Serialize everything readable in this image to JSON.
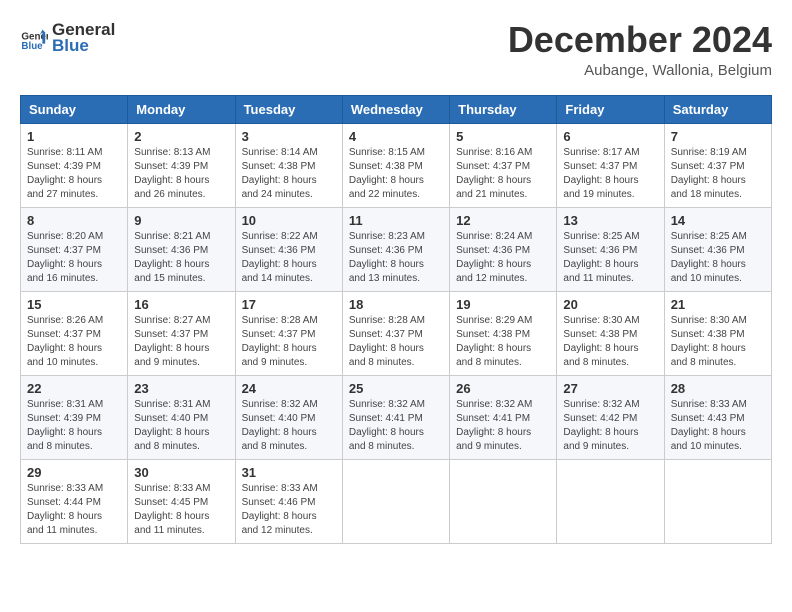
{
  "header": {
    "logo_general": "General",
    "logo_blue": "Blue",
    "month_title": "December 2024",
    "subtitle": "Aubange, Wallonia, Belgium"
  },
  "days_of_week": [
    "Sunday",
    "Monday",
    "Tuesday",
    "Wednesday",
    "Thursday",
    "Friday",
    "Saturday"
  ],
  "weeks": [
    [
      {
        "day": "1",
        "sunrise": "8:11 AM",
        "sunset": "4:39 PM",
        "daylight": "8 hours and 27 minutes."
      },
      {
        "day": "2",
        "sunrise": "8:13 AM",
        "sunset": "4:39 PM",
        "daylight": "8 hours and 26 minutes."
      },
      {
        "day": "3",
        "sunrise": "8:14 AM",
        "sunset": "4:38 PM",
        "daylight": "8 hours and 24 minutes."
      },
      {
        "day": "4",
        "sunrise": "8:15 AM",
        "sunset": "4:38 PM",
        "daylight": "8 hours and 22 minutes."
      },
      {
        "day": "5",
        "sunrise": "8:16 AM",
        "sunset": "4:37 PM",
        "daylight": "8 hours and 21 minutes."
      },
      {
        "day": "6",
        "sunrise": "8:17 AM",
        "sunset": "4:37 PM",
        "daylight": "8 hours and 19 minutes."
      },
      {
        "day": "7",
        "sunrise": "8:19 AM",
        "sunset": "4:37 PM",
        "daylight": "8 hours and 18 minutes."
      }
    ],
    [
      {
        "day": "8",
        "sunrise": "8:20 AM",
        "sunset": "4:37 PM",
        "daylight": "8 hours and 16 minutes."
      },
      {
        "day": "9",
        "sunrise": "8:21 AM",
        "sunset": "4:36 PM",
        "daylight": "8 hours and 15 minutes."
      },
      {
        "day": "10",
        "sunrise": "8:22 AM",
        "sunset": "4:36 PM",
        "daylight": "8 hours and 14 minutes."
      },
      {
        "day": "11",
        "sunrise": "8:23 AM",
        "sunset": "4:36 PM",
        "daylight": "8 hours and 13 minutes."
      },
      {
        "day": "12",
        "sunrise": "8:24 AM",
        "sunset": "4:36 PM",
        "daylight": "8 hours and 12 minutes."
      },
      {
        "day": "13",
        "sunrise": "8:25 AM",
        "sunset": "4:36 PM",
        "daylight": "8 hours and 11 minutes."
      },
      {
        "day": "14",
        "sunrise": "8:25 AM",
        "sunset": "4:36 PM",
        "daylight": "8 hours and 10 minutes."
      }
    ],
    [
      {
        "day": "15",
        "sunrise": "8:26 AM",
        "sunset": "4:37 PM",
        "daylight": "8 hours and 10 minutes."
      },
      {
        "day": "16",
        "sunrise": "8:27 AM",
        "sunset": "4:37 PM",
        "daylight": "8 hours and 9 minutes."
      },
      {
        "day": "17",
        "sunrise": "8:28 AM",
        "sunset": "4:37 PM",
        "daylight": "8 hours and 9 minutes."
      },
      {
        "day": "18",
        "sunrise": "8:28 AM",
        "sunset": "4:37 PM",
        "daylight": "8 hours and 8 minutes."
      },
      {
        "day": "19",
        "sunrise": "8:29 AM",
        "sunset": "4:38 PM",
        "daylight": "8 hours and 8 minutes."
      },
      {
        "day": "20",
        "sunrise": "8:30 AM",
        "sunset": "4:38 PM",
        "daylight": "8 hours and 8 minutes."
      },
      {
        "day": "21",
        "sunrise": "8:30 AM",
        "sunset": "4:38 PM",
        "daylight": "8 hours and 8 minutes."
      }
    ],
    [
      {
        "day": "22",
        "sunrise": "8:31 AM",
        "sunset": "4:39 PM",
        "daylight": "8 hours and 8 minutes."
      },
      {
        "day": "23",
        "sunrise": "8:31 AM",
        "sunset": "4:40 PM",
        "daylight": "8 hours and 8 minutes."
      },
      {
        "day": "24",
        "sunrise": "8:32 AM",
        "sunset": "4:40 PM",
        "daylight": "8 hours and 8 minutes."
      },
      {
        "day": "25",
        "sunrise": "8:32 AM",
        "sunset": "4:41 PM",
        "daylight": "8 hours and 8 minutes."
      },
      {
        "day": "26",
        "sunrise": "8:32 AM",
        "sunset": "4:41 PM",
        "daylight": "8 hours and 9 minutes."
      },
      {
        "day": "27",
        "sunrise": "8:32 AM",
        "sunset": "4:42 PM",
        "daylight": "8 hours and 9 minutes."
      },
      {
        "day": "28",
        "sunrise": "8:33 AM",
        "sunset": "4:43 PM",
        "daylight": "8 hours and 10 minutes."
      }
    ],
    [
      {
        "day": "29",
        "sunrise": "8:33 AM",
        "sunset": "4:44 PM",
        "daylight": "8 hours and 11 minutes."
      },
      {
        "day": "30",
        "sunrise": "8:33 AM",
        "sunset": "4:45 PM",
        "daylight": "8 hours and 11 minutes."
      },
      {
        "day": "31",
        "sunrise": "8:33 AM",
        "sunset": "4:46 PM",
        "daylight": "8 hours and 12 minutes."
      },
      null,
      null,
      null,
      null
    ]
  ]
}
